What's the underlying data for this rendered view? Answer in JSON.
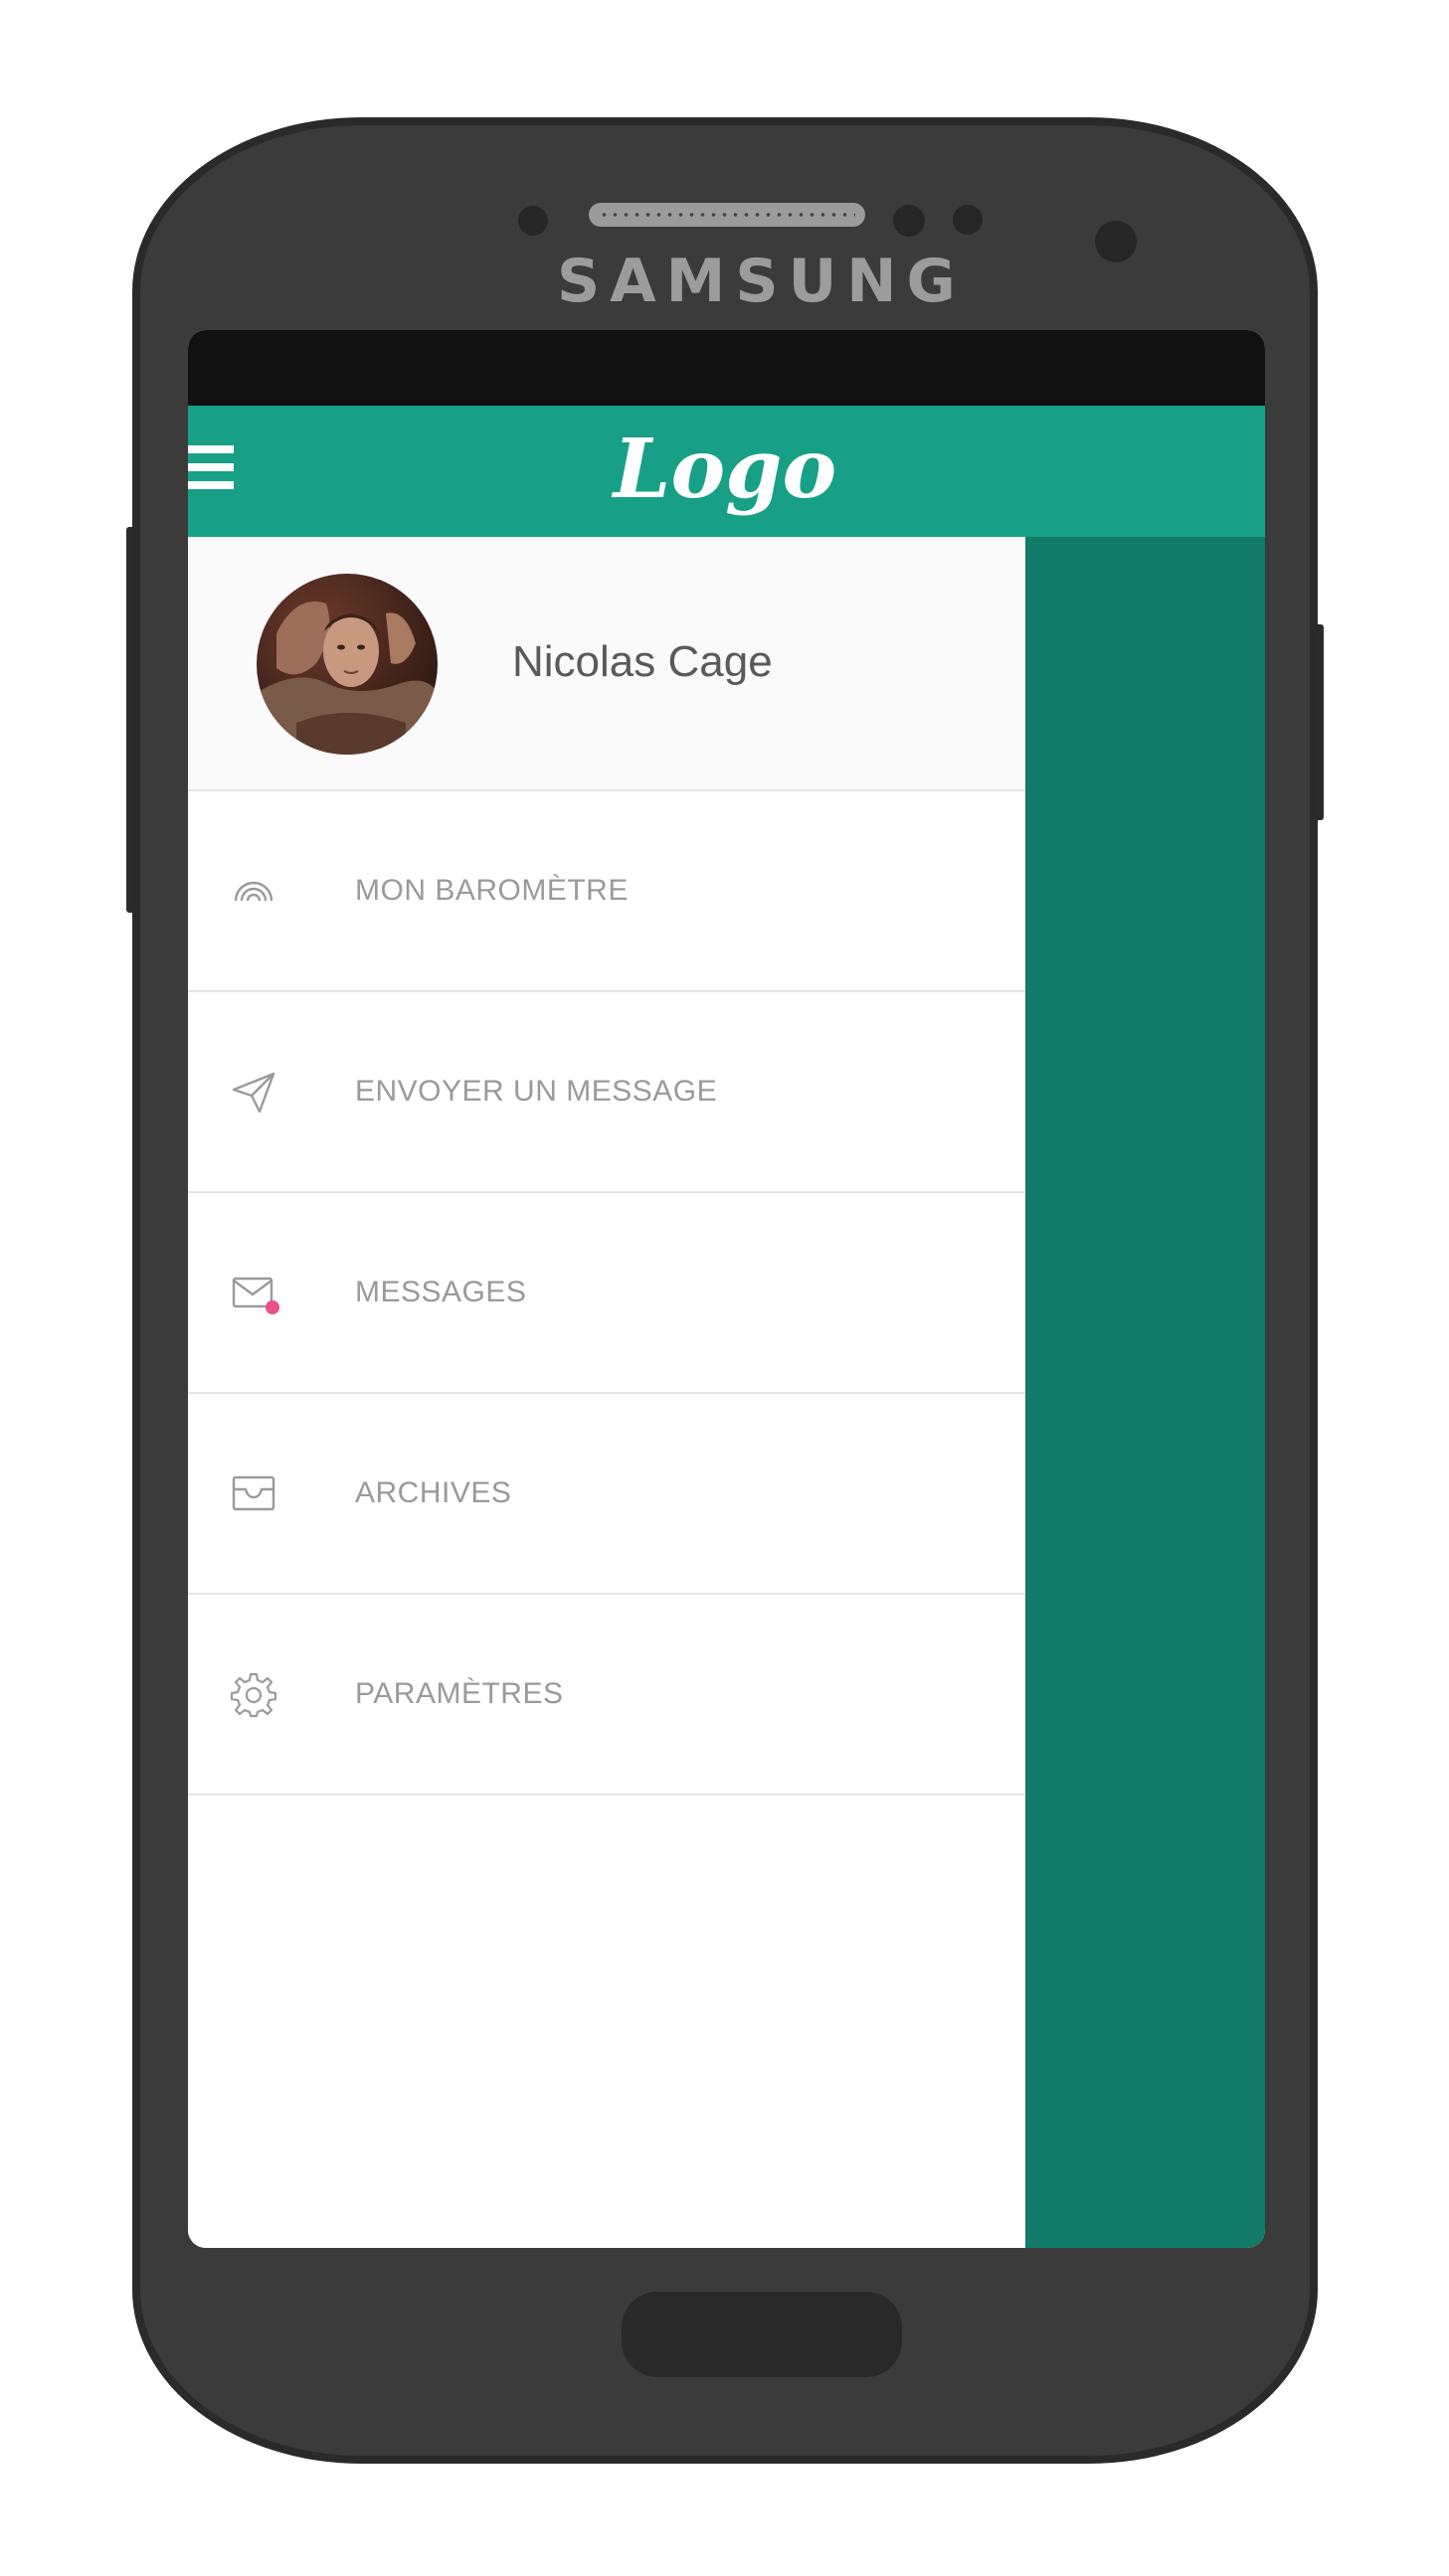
{
  "device": {
    "brand": "SAMSUNG"
  },
  "appbar": {
    "logo": "Logo",
    "background": "#18a086"
  },
  "drawer": {
    "user": {
      "name": "Nicolas Cage"
    },
    "items": [
      {
        "label": "MON BAROMÈTRE",
        "icon": "barometer-icon"
      },
      {
        "label": "ENVOYER UN MESSAGE",
        "icon": "send-icon"
      },
      {
        "label": "MESSAGES",
        "icon": "mail-icon",
        "has_notification": true
      },
      {
        "label": "ARCHIVES",
        "icon": "inbox-icon"
      },
      {
        "label": "PARAMÈTRES",
        "icon": "gear-icon"
      }
    ]
  },
  "colors": {
    "accent": "#18a086",
    "scrim": "#117b67",
    "notification_dot": "#e8518a",
    "menu_text": "#9a9a9a"
  }
}
